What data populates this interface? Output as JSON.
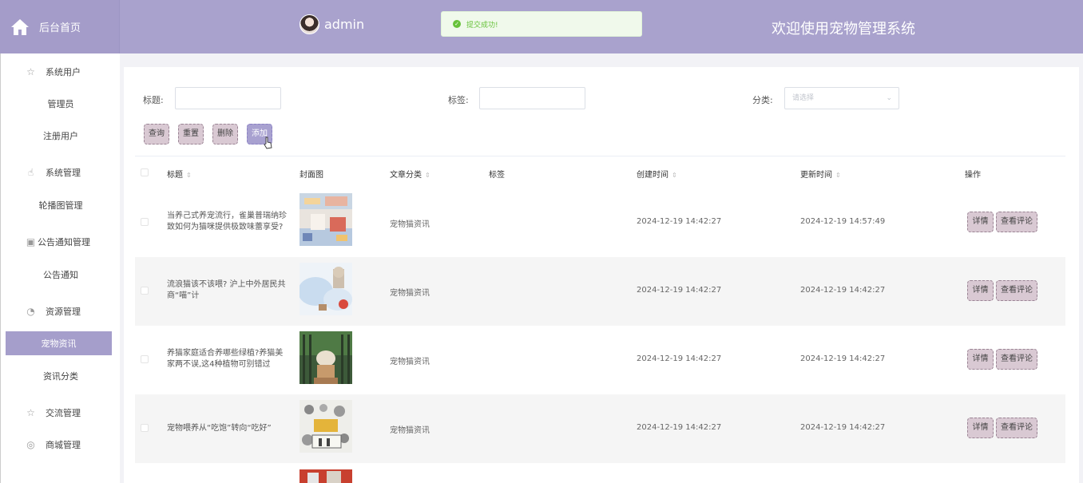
{
  "header": {
    "home_label": "后台首页",
    "username": "admin",
    "toast": "提交成功!",
    "system_title": "欢迎使用宠物管理系统"
  },
  "sidebar": {
    "items": [
      {
        "label": "系统用户",
        "type": "group",
        "icon": "star-icon"
      },
      {
        "label": "管理员",
        "type": "sub"
      },
      {
        "label": "注册用户",
        "type": "sub"
      },
      {
        "label": "系统管理",
        "type": "group",
        "icon": "hand-icon"
      },
      {
        "label": "轮播图管理",
        "type": "sub"
      },
      {
        "label": "公告通知管理",
        "type": "group",
        "icon": "bag-icon"
      },
      {
        "label": "公告通知",
        "type": "sub"
      },
      {
        "label": "资源管理",
        "type": "group",
        "icon": "pie-icon"
      },
      {
        "label": "宠物资讯",
        "type": "sub",
        "active": true
      },
      {
        "label": "资讯分类",
        "type": "sub"
      },
      {
        "label": "交流管理",
        "type": "group",
        "icon": "star-icon"
      },
      {
        "label": "商城管理",
        "type": "group",
        "icon": "compass-icon"
      }
    ]
  },
  "search": {
    "title_label": "标题:",
    "tag_label": "标签:",
    "category_label": "分类:",
    "category_placeholder": "请选择"
  },
  "toolbar": {
    "query": "查询",
    "reset": "重置",
    "delete": "删除",
    "add": "添加"
  },
  "table": {
    "columns": [
      "标题",
      "封面图",
      "文章分类",
      "标签",
      "创建时间",
      "更新时间",
      "操作"
    ],
    "rows": [
      {
        "title": "当养己式养宠流行，雀巢普瑞纳珍致如何为猫咪提供极致味蕾享受?",
        "category": "宠物猫资讯",
        "tag": "",
        "created": "2024-12-19 14:42:27",
        "updated": "2024-12-19 14:57:49"
      },
      {
        "title": "流浪猫该不该喂? 沪上中外居民共商“喵”计",
        "category": "宠物猫资讯",
        "tag": "",
        "created": "2024-12-19 14:42:27",
        "updated": "2024-12-19 14:42:27"
      },
      {
        "title": "养猫家庭适合养哪些绿植?养猫美家两不误,这4种植物可别错过",
        "category": "宠物猫资讯",
        "tag": "",
        "created": "2024-12-19 14:42:27",
        "updated": "2024-12-19 14:42:27"
      },
      {
        "title": "宠物喂养从“吃饱”转向“吃好”",
        "category": "宠物猫资讯",
        "tag": "",
        "created": "2024-12-19 14:42:27",
        "updated": "2024-12-19 14:42:27"
      }
    ],
    "detail_label": "详情",
    "comments_label": "查看评论"
  }
}
